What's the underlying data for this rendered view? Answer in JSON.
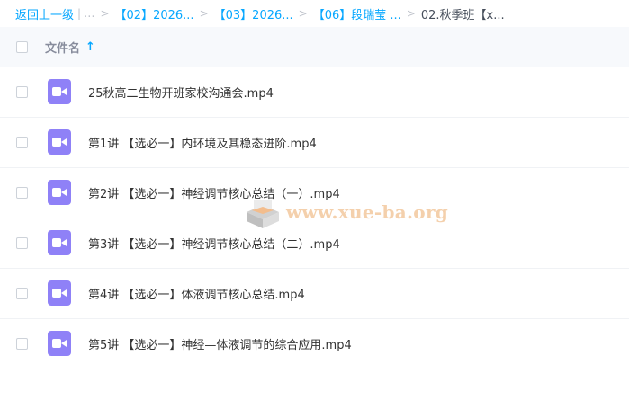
{
  "breadcrumb": {
    "back": "返回上一级",
    "ellipsis": "...",
    "items": [
      "【02】2026...",
      "【03】2026...",
      "【06】段瑞莹 ..."
    ],
    "current": "02.秋季班【x..."
  },
  "list_header": {
    "name_label": "文件名",
    "sort_icon": "arrow-up-icon"
  },
  "files": [
    {
      "name": "25秋高二生物开班家校沟通会.mp4",
      "icon": "video-file-icon"
    },
    {
      "name": "第1讲 【选必一】内环境及其稳态进阶.mp4",
      "icon": "video-file-icon"
    },
    {
      "name": "第2讲 【选必一】神经调节核心总结（一）.mp4",
      "icon": "video-file-icon"
    },
    {
      "name": "第3讲 【选必一】神经调节核心总结（二）.mp4",
      "icon": "video-file-icon"
    },
    {
      "name": "第4讲 【选必一】体液调节核心总结.mp4",
      "icon": "video-file-icon"
    },
    {
      "name": "第5讲 【选必一】神经—体液调节的综合应用.mp4",
      "icon": "video-file-icon"
    }
  ],
  "watermark": {
    "text": "www.xue-ba.org"
  },
  "colors": {
    "accent": "#06a7ff",
    "video_icon": "#8f81f7",
    "header_bg": "#f7f9fc"
  }
}
